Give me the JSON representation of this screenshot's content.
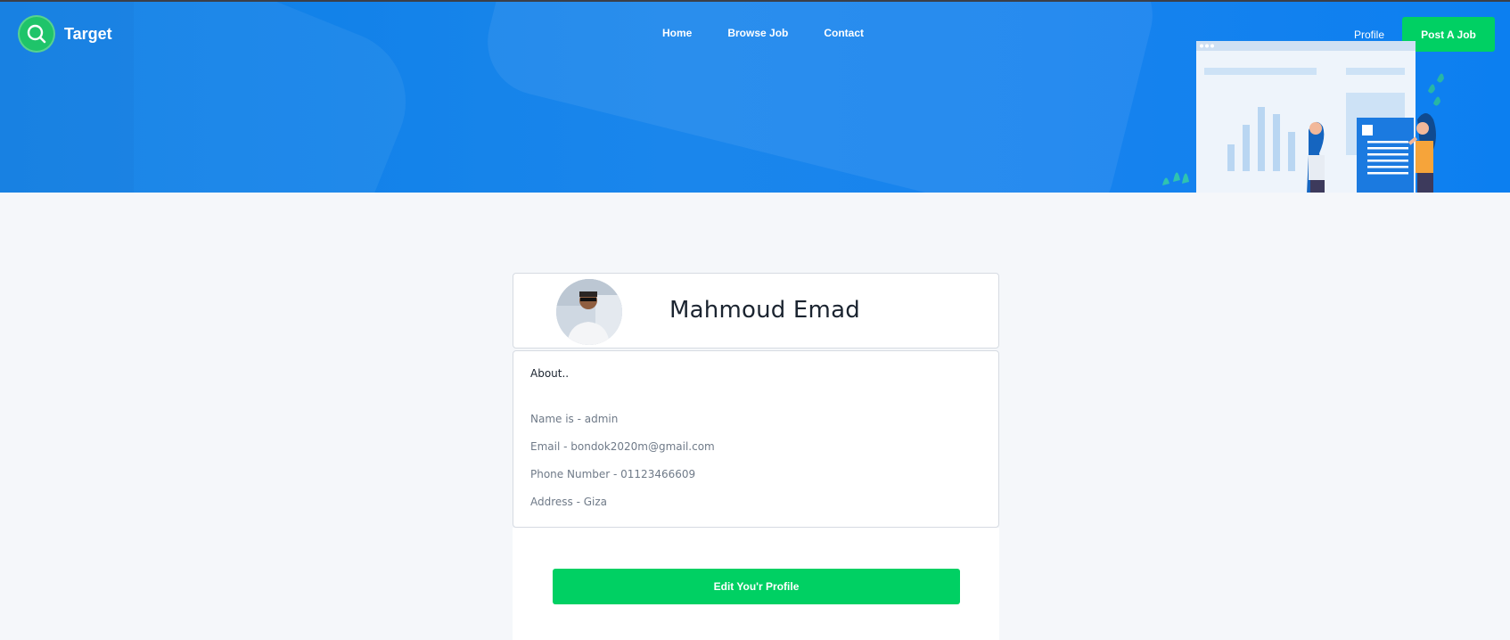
{
  "brand": {
    "name": "Target"
  },
  "nav": [
    {
      "label": "Home"
    },
    {
      "label": "Browse Job"
    },
    {
      "label": "Contact"
    }
  ],
  "header_actions": {
    "profile_label": "Profile",
    "post_job_label": "Post A Job"
  },
  "profile": {
    "name": "Mahmoud Emad",
    "about_title": "About..",
    "details": [
      "Name is - admin",
      "Email - bondok2020m@gmail.com",
      "Phone Number - 01123466609",
      "Address - Giza"
    ],
    "edit_label": "Edit You'r Profile"
  },
  "colors": {
    "hero_blue": "#0b7ee6",
    "accent_green": "#00d063"
  },
  "icons": [
    "search-icon",
    "hero-illustration",
    "avatar-photo"
  ]
}
